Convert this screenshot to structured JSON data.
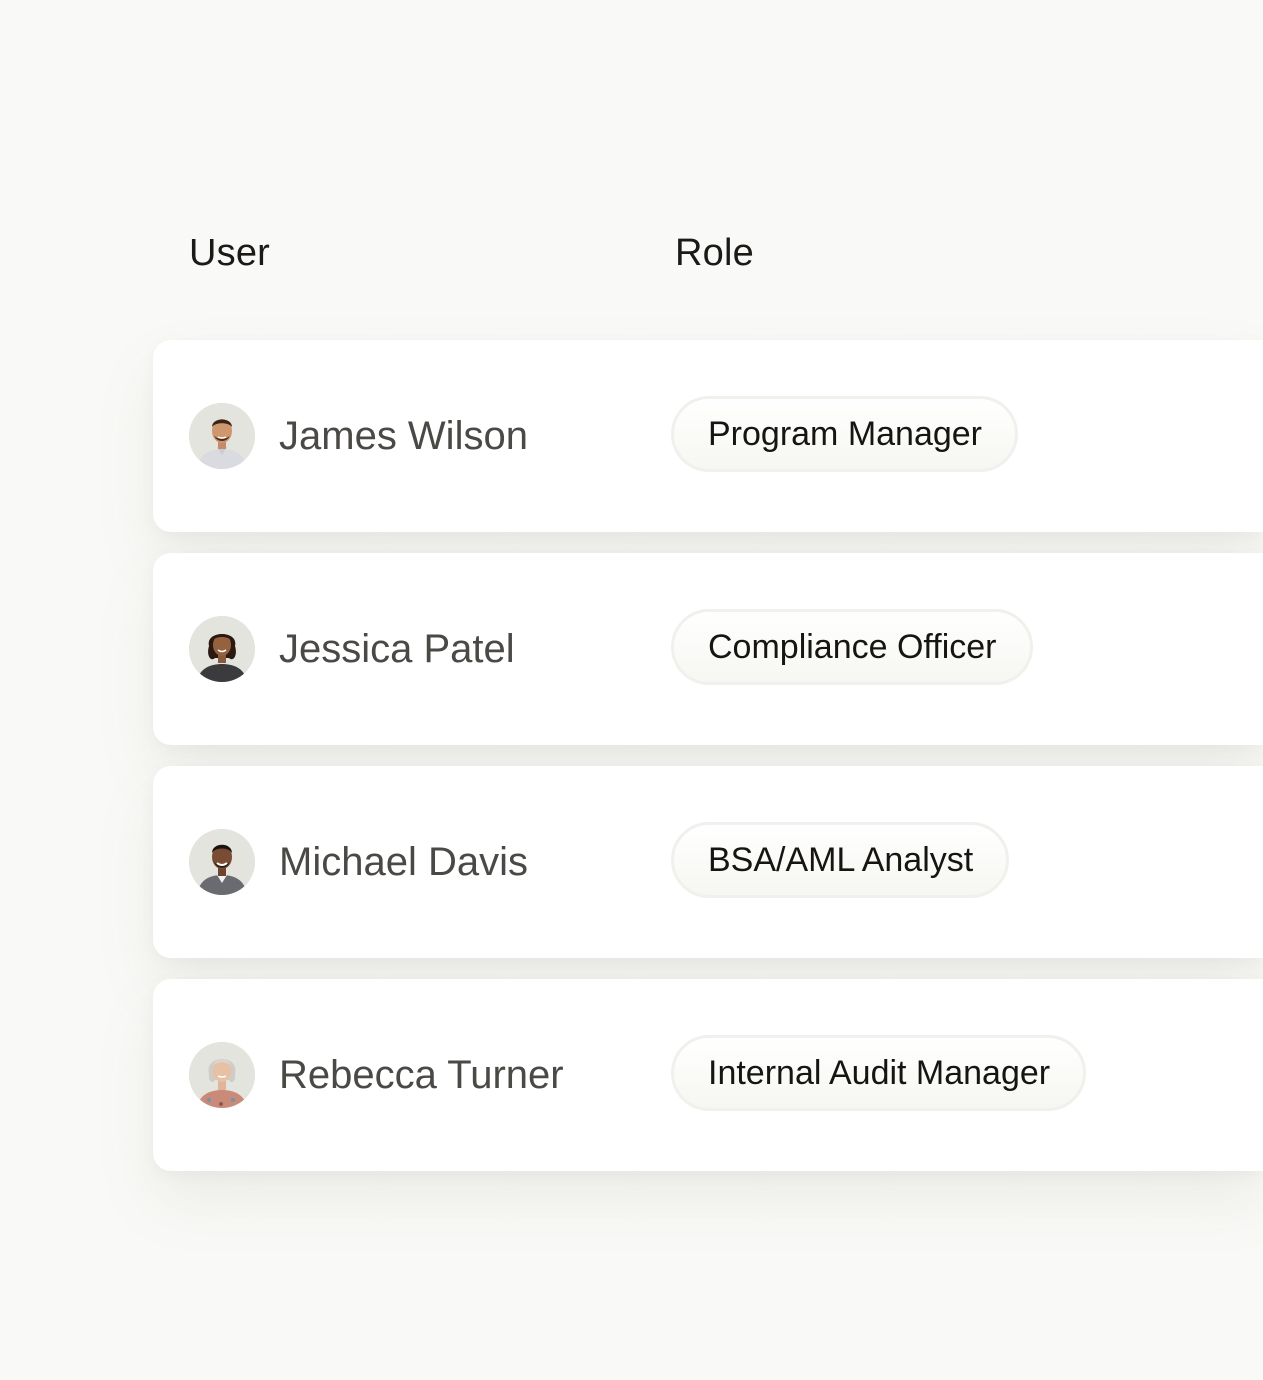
{
  "table": {
    "columns": {
      "user": "User",
      "role": "Role"
    },
    "rows": [
      {
        "name": "James Wilson",
        "role": "Program Manager",
        "avatar": "avatar-photo"
      },
      {
        "name": "Jessica Patel",
        "role": "Compliance Officer",
        "avatar": "avatar-photo"
      },
      {
        "name": "Michael Davis",
        "role": "BSA/AML Analyst",
        "avatar": "avatar-photo"
      },
      {
        "name": "Rebecca Turner",
        "role": "Internal Audit Manager",
        "avatar": "avatar-photo"
      }
    ]
  },
  "colors": {
    "background": "#f9f9f7",
    "card": "#ffffff",
    "heading_text": "#1c1a17",
    "name_text": "#4b4945",
    "chip_border": "#f0f0ec"
  }
}
